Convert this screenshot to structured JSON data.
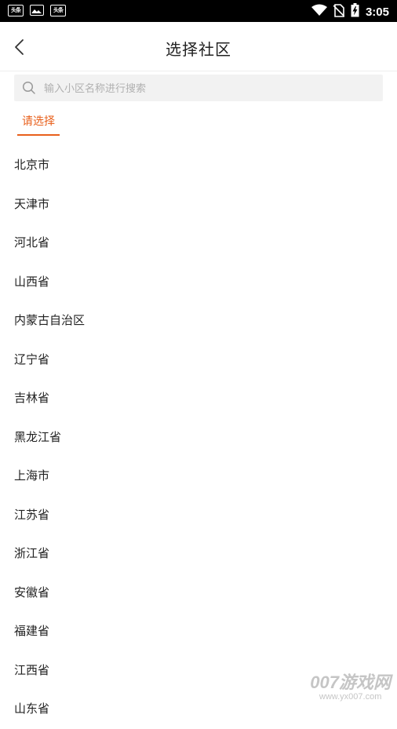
{
  "status_bar": {
    "app_icon_label": "头条",
    "time": "3:05"
  },
  "header": {
    "title": "选择社区"
  },
  "search": {
    "placeholder": "输入小区名称进行搜索",
    "value": ""
  },
  "tabs": {
    "current_label": "请选择"
  },
  "regions": [
    "北京市",
    "天津市",
    "河北省",
    "山西省",
    "内蒙古自治区",
    "辽宁省",
    "吉林省",
    "黑龙江省",
    "上海市",
    "江苏省",
    "浙江省",
    "安徽省",
    "福建省",
    "江西省",
    "山东省"
  ],
  "watermark": {
    "main": "007游戏网",
    "sub": "www.yx007.com"
  }
}
